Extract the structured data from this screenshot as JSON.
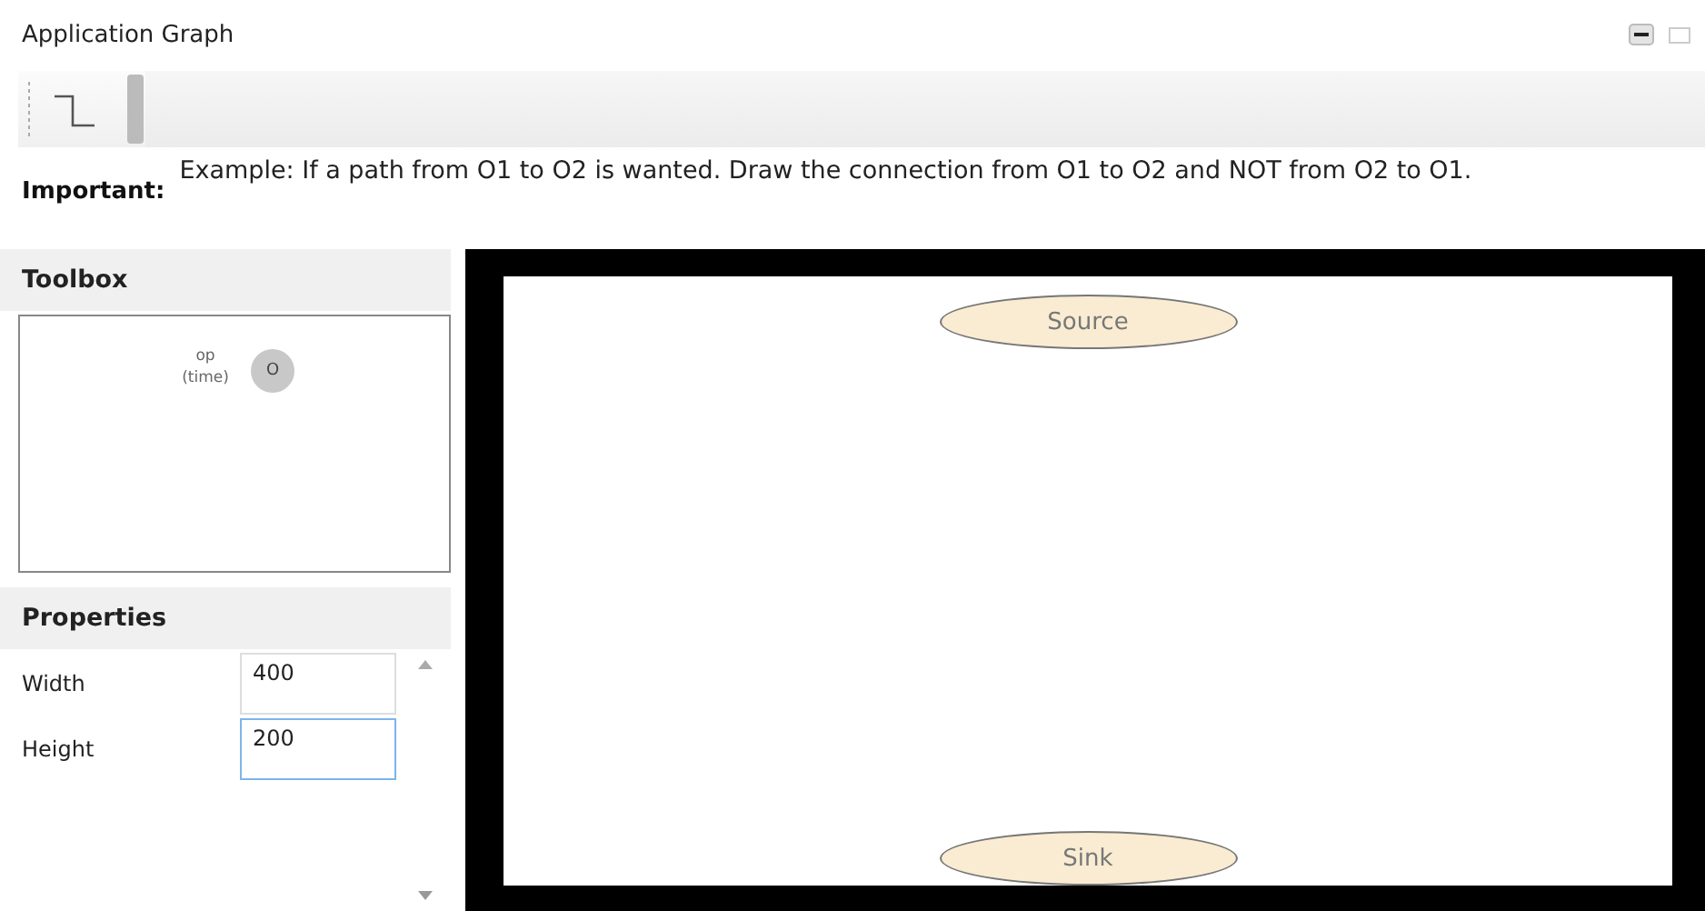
{
  "window": {
    "title": "Application Graph"
  },
  "note": {
    "label": "Important:",
    "text": "Example: If a path from O1 to O2 is wanted. Draw the connection from O1 to O2 and NOT from O2 to O1."
  },
  "toolbox": {
    "title": "Toolbox",
    "items": [
      {
        "label": "op (time)",
        "glyph": "O"
      }
    ]
  },
  "properties": {
    "title": "Properties",
    "rows": [
      {
        "name": "Width",
        "value": "400",
        "focused": false
      },
      {
        "name": "Height",
        "value": "200",
        "focused": true
      }
    ]
  },
  "canvas": {
    "nodes": [
      {
        "label": "Source",
        "kind": "source"
      },
      {
        "label": "Sink",
        "kind": "sink"
      }
    ]
  }
}
